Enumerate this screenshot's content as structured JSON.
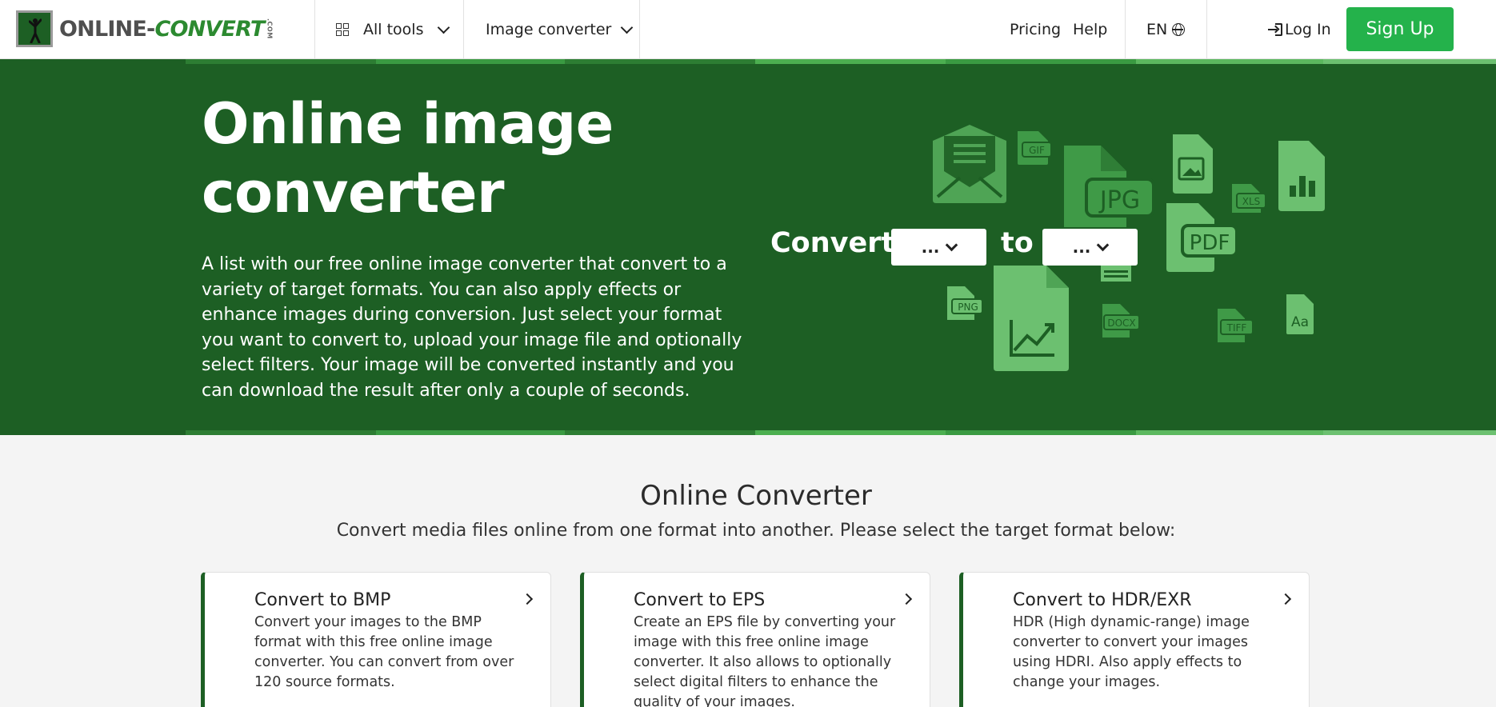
{
  "header": {
    "logo_text_bold": "ONLINE",
    "logo_text_dash": "-",
    "logo_text_italic": "CONVERT",
    "logo_suffix": ".COM",
    "all_tools": "All tools",
    "image_converter": "Image converter",
    "pricing": "Pricing",
    "help": "Help",
    "language": "EN",
    "login": "Log In",
    "signup": "Sign Up"
  },
  "hero": {
    "title": "Online image converter",
    "description": "A list with our free online image converter that convert to a variety of target formats. You can also apply effects or enhance images during conversion. Just select your format you want to convert to, upload your image file and optionally select filters. Your image will be converted instantly and you can download the result after only a couple of seconds.",
    "convert_label": "Convert",
    "from_value": "...",
    "to_label": "to",
    "to_value": "...",
    "file_badges": [
      "GIF",
      "JPG",
      "XLS",
      "PDF",
      "PNG",
      "DOCX",
      "TIFF",
      "Aa"
    ]
  },
  "section": {
    "title": "Online Converter",
    "subtitle": "Convert media files online from one format into another. Please select the target format below:"
  },
  "cards": [
    {
      "title": "Convert to BMP",
      "description": "Convert your images to the BMP format with this free online image converter. You can convert from over 120 source formats."
    },
    {
      "title": "Convert to EPS",
      "description": "Create an EPS file by converting your image with this free online image converter. It also allows to optionally select digital filters to enhance the quality of your images."
    },
    {
      "title": "Convert to HDR/EXR",
      "description": "HDR (High dynamic-range) image converter to convert your images using HDRI. Also apply effects to change your images."
    }
  ],
  "colors": {
    "hero_bg": "#1d5f24",
    "brand_green": "#24b24b",
    "icon_green": "#3f9a47",
    "icon_green_light": "#6cc070"
  }
}
